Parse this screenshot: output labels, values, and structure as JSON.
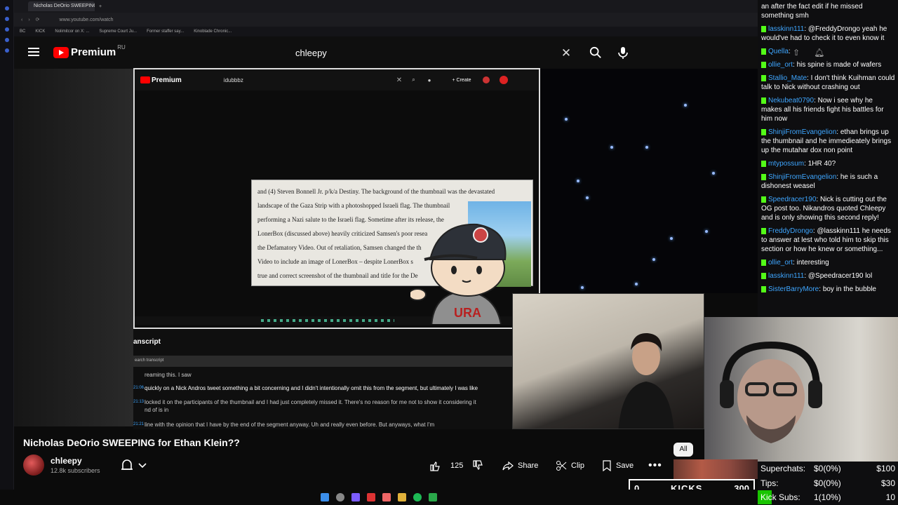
{
  "browser": {
    "tab_title": "Nicholas DeOrio SWEEPING",
    "url": "www.youtube.com/watch",
    "bookmarks": [
      "BC",
      "KICK",
      "Nolimitcor on X: ...",
      "Supreme Court Ju...",
      "Former staffer say...",
      "Kinoblade Chronic..."
    ]
  },
  "yt": {
    "logo_word": "Premium",
    "region": "RU",
    "search_value": "chleepy"
  },
  "inner_video": {
    "logo_word": "Premium",
    "search_value": "idubbbz",
    "create_label": "+ Create",
    "document_lines": [
      "and (4) Steven Bonnell Jr. p/k/a Destiny. The background of the thumbnail was the devastated",
      "landscape of the Gaza Strip with a photoshopped Israeli flag. The thumbnail",
      "performing a Nazi salute to the Israeli flag. Sometime after its release, the",
      "LonerBox (discussed above) heavily criticized Samsen's poor resea",
      "the Defamatory Video. Out of retaliation, Samsen changed the th",
      "Video to include an image of LonerBox – despite LonerBox s",
      "true and correct screenshot of the thumbnail and title for the De"
    ]
  },
  "transcript": {
    "title": "anscript",
    "search_placeholder": "earch transcript",
    "rows": [
      {
        "ts": "",
        "text": "reaming this. I saw"
      },
      {
        "ts": "21:06",
        "text": "quickly on a Nick Andros tweet something a bit concerning and I didn't intentionally omit this from the segment, but ultimately I was like"
      },
      {
        "ts": "21:13",
        "text": "locked it on the participants of the thumbnail and I had just completely missed it. There's no reason for me not to show it considering it"
      },
      {
        "ts": "",
        "text": "nd of is in"
      },
      {
        "ts": "21:21",
        "text": "line with the opinion that I have by the end of the segment anyway. Uh and really even before. But anyways, what I'm"
      }
    ]
  },
  "video": {
    "title": "Nicholas DeOrio SWEEPING for Ethan Klein??",
    "channel": "chleepy",
    "subscribers": "12.8k subscribers",
    "likes": "125",
    "share_label": "Share",
    "clip_label": "Clip",
    "save_label": "Save",
    "chip_all": "All"
  },
  "chat": [
    {
      "user": "",
      "text": "an after the fact edit if he missed something smh"
    },
    {
      "user": "lasskinn111",
      "text": "@FreddyDrongo yeah he would've had to check it to even know it"
    },
    {
      "user": "Quella",
      "text": ""
    },
    {
      "user": "ollie_ort",
      "text": "his spine is made of wafers"
    },
    {
      "user": "Stallio_Mate",
      "text": "I don't think Kuihman could talk to Nick without crashing out"
    },
    {
      "user": "Nekubeat0790",
      "text": "Now i see why he makes all his friends fight his battles for him now"
    },
    {
      "user": "ShinjiFromEvangelion",
      "text": "ethan brings up the thumbnail and he immedieately brings up the mutahar dox non point"
    },
    {
      "user": "mtypossum",
      "text": "1HR 40?"
    },
    {
      "user": "ShinjiFromEvangelion",
      "text": "he is such a dishonest weasel"
    },
    {
      "user": "Speedracer190",
      "text": "Nick is cutting out the OG post too. Nikandros quoted Chleepy and is only showing this second reply!"
    },
    {
      "user": "FreddyDrongo",
      "text": "@lasskinn111 he needs to answer at lest who told him to skip this section or how he knew or something..."
    },
    {
      "user": "ollie_ort",
      "text": "interesting"
    },
    {
      "user": "lasskinn111",
      "text": "@Speedracer190 lol"
    },
    {
      "user": "SisterBarryMore",
      "text": "boy in the bubble"
    }
  ],
  "kicks": {
    "left": "0",
    "label": "KICKS",
    "right": "300"
  },
  "stats": [
    {
      "name": "Superchats:",
      "value": "$0(0%)",
      "goal": "$100"
    },
    {
      "name": "Tips:",
      "value": "$0(0%)",
      "goal": "$30"
    },
    {
      "name": "Kick Subs:",
      "value": "1(10%)",
      "goal": "10"
    }
  ],
  "colors": {
    "accent": "#3ea6ff",
    "kick_green": "#53fc18",
    "yt_red": "#ff0000"
  }
}
